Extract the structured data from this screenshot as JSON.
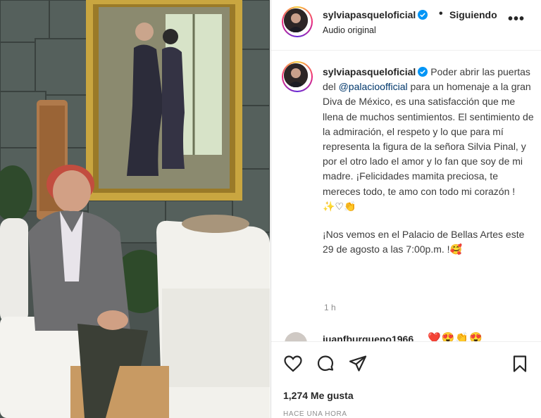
{
  "header": {
    "username": "sylviapasqueloficial",
    "separator": "•",
    "follow_label": "Siguiendo",
    "audio_label": "Audio original",
    "more_label": "•••"
  },
  "caption": {
    "username": "sylviapasqueloficial",
    "text_1": "Poder abrir las puertas del",
    "mention": "@palacioofficial",
    "text_2": "para un homenaje a la gran Diva de México, es una satisfacción que me llena de muchos sentimientos. El sentimiento de la admiración, el respeto y lo que para mí representa la figura de la señora Silvia Pinal, y por el otro lado el amor y lo fan que soy de mi madre. ¡Felicidades mamita preciosa, te mereces todo, te amo con todo mi corazón ! ✨♡👏",
    "text_3": "¡Nos vemos en el Palacio de Bellas Artes este 29 de agosto a las 7:00p.m. !🥰",
    "time": "1 h"
  },
  "comment": {
    "username": "juanfburgueno1966",
    "emojis": "❤️😍👏😍"
  },
  "actions": {
    "likes": "1,274 Me gusta",
    "posted_ago": "HACE UNA HORA"
  },
  "icons": {
    "like": "heart-icon",
    "comment": "comment-icon",
    "share": "share-icon",
    "save": "bookmark-icon",
    "verified": "verified-badge-icon"
  },
  "colors": {
    "verified": "#0095f6",
    "mention": "#00376b",
    "muted": "#8e8e8e"
  }
}
